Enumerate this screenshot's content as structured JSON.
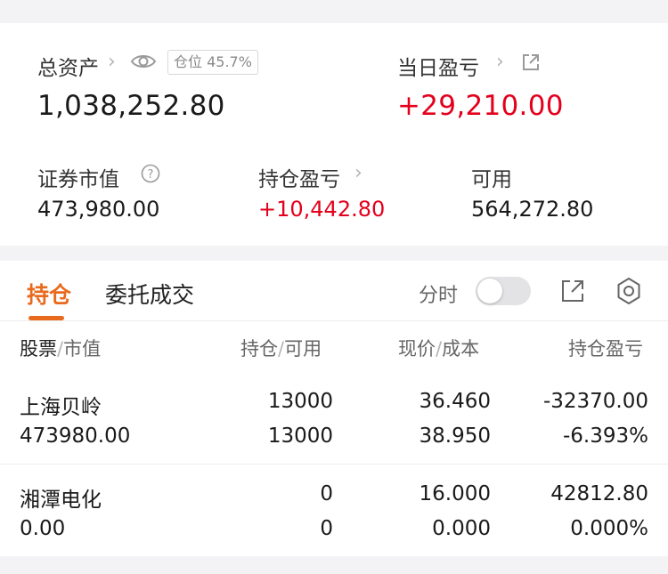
{
  "summary": {
    "total_assets_label": "总资产",
    "total_assets_value": "1,038,252.80",
    "position_badge": "仓位 45.7%",
    "daily_pl_label": "当日盈亏",
    "daily_pl_value": "+29,210.00",
    "market_value_label": "证券市值",
    "market_value_value": "473,980.00",
    "holding_pl_label": "持仓盈亏",
    "holding_pl_value": "+10,442.80",
    "available_label": "可用",
    "available_value": "564,272.80"
  },
  "tabs": {
    "holdings": "持仓",
    "orders": "委托成交"
  },
  "toolbar": {
    "intraday_label": "分时"
  },
  "table": {
    "col1_a": "股票",
    "col1_b": "市值",
    "col2_a": "持仓",
    "col2_b": "可用",
    "col3_a": "现价",
    "col3_b": "成本",
    "col4": "持仓盈亏",
    "rows": [
      {
        "name": "上海贝岭",
        "market_value": "473980.00",
        "holding": "13000",
        "available": "13000",
        "price": "36.460",
        "cost": "38.950",
        "pl": "-32370.00",
        "pl_pct": "-6.393%"
      },
      {
        "name": "湘潭电化",
        "market_value": "0.00",
        "holding": "0",
        "available": "0",
        "price": "16.000",
        "cost": "0.000",
        "pl": "42812.80",
        "pl_pct": "0.000%"
      }
    ]
  },
  "colors": {
    "accent": "#e86a1c",
    "gain": "#e4001c",
    "loss": "#2e9b30"
  }
}
